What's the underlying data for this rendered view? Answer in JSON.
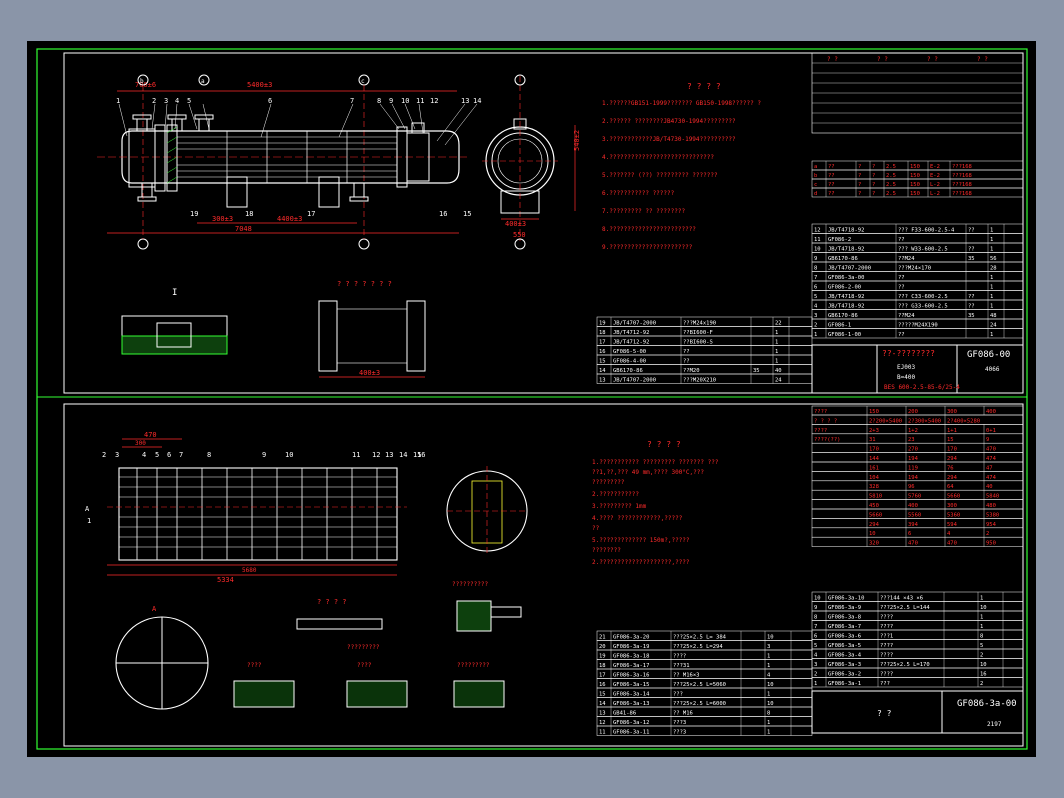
{
  "upper_sheet": {
    "notes_title": "? ? ? ?",
    "notes": [
      "1.??????GB151-1999??????? GB150-1998?????? ?",
      "2.??????  ????????JB4730-1994?????????",
      "3.????????????JB/T4730-1994??????????",
      "4.?????????????????????????????",
      "5.??????? (??) ????????? ???????",
      "6.??????????? ??????",
      "7.????????? ?? ????????",
      "8.????????????????????????",
      "9.???????????????????????"
    ],
    "dims": {
      "top_a": "700±6",
      "top_b": "5400±3",
      "bottom_a": "300±3",
      "bottom_b": "4400±3",
      "bottom_total": "7048",
      "side_a": "540±2",
      "side_b": "400±3",
      "side_c": "550",
      "detail_a": "400±3"
    },
    "axis_marks": [
      "b",
      "a",
      "c",
      "d",
      "e"
    ],
    "part_numbers_top": [
      "1",
      "2",
      "3",
      "4",
      "5",
      "6",
      "7",
      "8",
      "9",
      "10",
      "11",
      "12",
      "13",
      "14"
    ],
    "part_numbers_bottom": [
      "19",
      "18",
      "17",
      "16",
      "15"
    ],
    "section_label": "I",
    "detail_title": "? ? ? ? ? ? ?",
    "title_block": {
      "drawing_no": "GF086-00",
      "name": "??-????????",
      "spec": "BES 600-2.5-85-6/25-4",
      "scale": "EJ003",
      "weight": "4066",
      "b_value": "B=400"
    },
    "design_table_header": [
      "? ?",
      "? ?",
      "? ?",
      "? ?"
    ],
    "nozzle_table": [
      [
        "a",
        "??",
        "?",
        "?",
        "2.5",
        "150",
        "E-2",
        "???168"
      ],
      [
        "b",
        "??",
        "?",
        "?",
        "2.5",
        "150",
        "E-2",
        "???168"
      ],
      [
        "c",
        "??",
        "?",
        "?",
        "2.5",
        "150",
        "L-2",
        "???168"
      ],
      [
        "d",
        "??",
        "?",
        "?",
        "2.5",
        "150",
        "L-2",
        "???168"
      ]
    ],
    "bom_upper": [
      [
        "12",
        "JB/T4718-92",
        "??? F33-600-2.5-4",
        "??",
        "1",
        ""
      ],
      [
        "11",
        "GF086-2",
        "??",
        "",
        "1",
        ""
      ],
      [
        "10",
        "JB/T4718-92",
        "??? W33-600-2.5",
        "??",
        "1",
        ""
      ],
      [
        "9",
        "GB6170-86",
        "??M24",
        "35",
        "56",
        "",
        ""
      ],
      [
        "8",
        "JB/T4707-2000",
        "???M24×170",
        "",
        "28",
        ""
      ],
      [
        "7",
        "GF086-3a-00",
        "??",
        "",
        "1",
        ""
      ],
      [
        "6",
        "GF086-2-00",
        "??",
        "",
        "1",
        ""
      ],
      [
        "5",
        "JB/T4718-92",
        "??? C33-600-2.5",
        "??",
        "1",
        ""
      ],
      [
        "4",
        "JB/T4718-92",
        "??? G33-600-2.5",
        "??",
        "1",
        ""
      ],
      [
        "3",
        "GB6170-86",
        "??M24",
        "35",
        "48",
        ""
      ],
      [
        "2",
        "GF086-1",
        "?????M24X190",
        "",
        "24",
        ""
      ],
      [
        "1",
        "GF086-1-00",
        "??",
        "",
        "1",
        ""
      ]
    ],
    "bom_lower": [
      [
        "19",
        "JB/T4707-2000",
        "???M24x190",
        "",
        "22",
        ""
      ],
      [
        "18",
        "JB/T4712-92",
        "??BI600-F",
        "",
        "1",
        ""
      ],
      [
        "17",
        "JB/T4712-92",
        "??BI600-S",
        "",
        "1",
        ""
      ],
      [
        "16",
        "GF086-5-00",
        "??",
        "",
        "1",
        ""
      ],
      [
        "15",
        "GF086-4-00",
        "??",
        "",
        "1",
        ""
      ],
      [
        "14",
        "GB6170-86",
        "??M20",
        "35",
        "40",
        ""
      ],
      [
        "13",
        "JB/T4707-2000",
        "???M20X210",
        "",
        "24",
        ""
      ]
    ]
  },
  "lower_sheet": {
    "notes_title": "? ? ? ?",
    "notes": [
      "1.??????????? ????????? ??????? ???",
      "  ??1,??,??? 49 mm,???? 300°C,???",
      "  ?????????",
      "2.???????????",
      "3.????????? 1mm",
      "4.???? ????????????,?????",
      "  ??",
      "5.????????????? 150m?,?????",
      "  ????????",
      "2.????????????????????,????"
    ],
    "dims": {
      "top_a": "470",
      "top_b": "300",
      "overall": "5334",
      "sub": "5680"
    },
    "part_numbers": [
      "2",
      "3",
      "4",
      "5",
      "6",
      "7",
      "8",
      "9",
      "10",
      "11",
      "12",
      "13",
      "14",
      "15",
      "16",
      "1"
    ],
    "section_labels": [
      "A",
      "A",
      "??????????",
      "? ? ? ?",
      "?????????",
      "????",
      "????",
      "?????????"
    ],
    "title_block": {
      "drawing_no": "GF086-3a-00",
      "name": "?      ?",
      "weight": "2197"
    },
    "spec_table_header": [
      "????",
      "150",
      "200",
      "300",
      "400"
    ],
    "spec_table": [
      [
        "? ? ? ?",
        "2?150×5550",
        "2?200×5400",
        "2?300×5400",
        "2?400×5280"
      ],
      [
        "????",
        "",
        "2+3",
        "1+2",
        "1+1",
        "0+1"
      ],
      [
        "????(??)",
        "",
        "31",
        "23",
        "15",
        "9"
      ],
      [
        "",
        "",
        "170",
        "270",
        "170",
        "470"
      ],
      [
        "",
        "",
        "144",
        "194",
        "294",
        "474"
      ],
      [
        "",
        "",
        "161",
        "119",
        "76",
        "47"
      ],
      [
        "",
        "",
        "104",
        "194",
        "294",
        "474"
      ],
      [
        "",
        "",
        "328",
        "96",
        "64",
        "40"
      ],
      [
        "",
        "",
        "5810",
        "5760",
        "5660",
        "5840"
      ],
      [
        "",
        "",
        "450",
        "400",
        "300",
        "480"
      ],
      [
        "",
        "",
        "5660",
        "5560",
        "5360",
        "5380"
      ],
      [
        "",
        "",
        "294",
        "394",
        "594",
        "954"
      ],
      [
        "",
        "",
        "10",
        "6",
        "4",
        "2"
      ],
      [
        "",
        "",
        "320",
        "470",
        "470",
        "950"
      ]
    ],
    "bom_upper": [
      [
        "10",
        "GF086-3a-10",
        "???144 ×43 ×6",
        "",
        "1",
        ""
      ],
      [
        "9",
        "GF086-3a-9",
        "???25×2.5 L=144",
        "",
        "10",
        ""
      ],
      [
        "8",
        "GF086-3a-8",
        "????",
        "",
        "1",
        ""
      ],
      [
        "7",
        "GF086-3a-7",
        "????",
        "",
        "1",
        ""
      ],
      [
        "6",
        "GF086-3a-6",
        "???1",
        "",
        "8",
        ""
      ],
      [
        "5",
        "GF086-3a-5",
        "????",
        "",
        "5",
        ""
      ],
      [
        "4",
        "GF086-3a-4",
        "????",
        "",
        "2",
        ""
      ],
      [
        "3",
        "GF086-3a-3",
        "???25×2.5 L=170",
        "",
        "10",
        ""
      ],
      [
        "2",
        "GF086-3a-2",
        "????",
        "",
        "16",
        ""
      ],
      [
        "1",
        "GF086-3a-1",
        "???",
        "",
        "2",
        ""
      ]
    ],
    "bom_lower": [
      [
        "21",
        "GF086-3a-20",
        "???25×2.5 L= 384",
        "",
        "10",
        ""
      ],
      [
        "20",
        "GF086-3a-19",
        "???25×2.5 L=294",
        "",
        "3",
        ""
      ],
      [
        "19",
        "GF086-3a-18",
        "????",
        "",
        "1",
        ""
      ],
      [
        "18",
        "GF086-3a-17",
        "???31",
        "",
        "1",
        ""
      ],
      [
        "17",
        "GF086-3a-16",
        "?? M16×3",
        "",
        "4",
        ""
      ],
      [
        "16",
        "GF086-3a-15",
        "???25×2.5 L=5060",
        "",
        "10",
        ""
      ],
      [
        "15",
        "GF086-3a-14",
        "???",
        "",
        "1",
        ""
      ],
      [
        "14",
        "GF086-3a-13",
        "???25×2.5 L=6000",
        "",
        "10",
        ""
      ],
      [
        "13",
        "GB41-86",
        "?? M16",
        "",
        "8",
        ""
      ],
      [
        "12",
        "GF086-3a-12",
        "???3",
        "",
        "1",
        ""
      ],
      [
        "11",
        "GF086-3a-11",
        "???3",
        "",
        "1",
        ""
      ]
    ]
  },
  "colors": {
    "background": "#000000",
    "border": "#33ff33",
    "geometry": "#ffffff",
    "dimension": "#ff2b2b",
    "text": "#ffff33",
    "frame_outer": "#8a95a8"
  }
}
